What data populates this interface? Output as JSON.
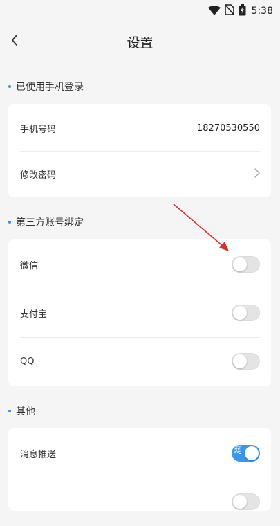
{
  "status_bar": {
    "time": "5:38"
  },
  "nav": {
    "title": "设置"
  },
  "sections": {
    "login": {
      "title": "已使用手机登录",
      "phone_label": "手机号码",
      "phone_value": "18270530550",
      "password_label": "修改密码"
    },
    "third_party": {
      "title": "第三方账号绑定",
      "wechat_label": "微信",
      "wechat_enabled": false,
      "alipay_label": "支付宝",
      "alipay_enabled": false,
      "qq_label": "QQ",
      "qq_enabled": false
    },
    "other": {
      "title": "其他",
      "push_label": "消息推送",
      "push_enabled": true,
      "next_enabled": false
    }
  },
  "colors": {
    "accent": "#3a98ec",
    "annotation_arrow": "#d9302a",
    "background": "#f5f5f5"
  },
  "overlay": {
    "watermark_text": "网"
  }
}
